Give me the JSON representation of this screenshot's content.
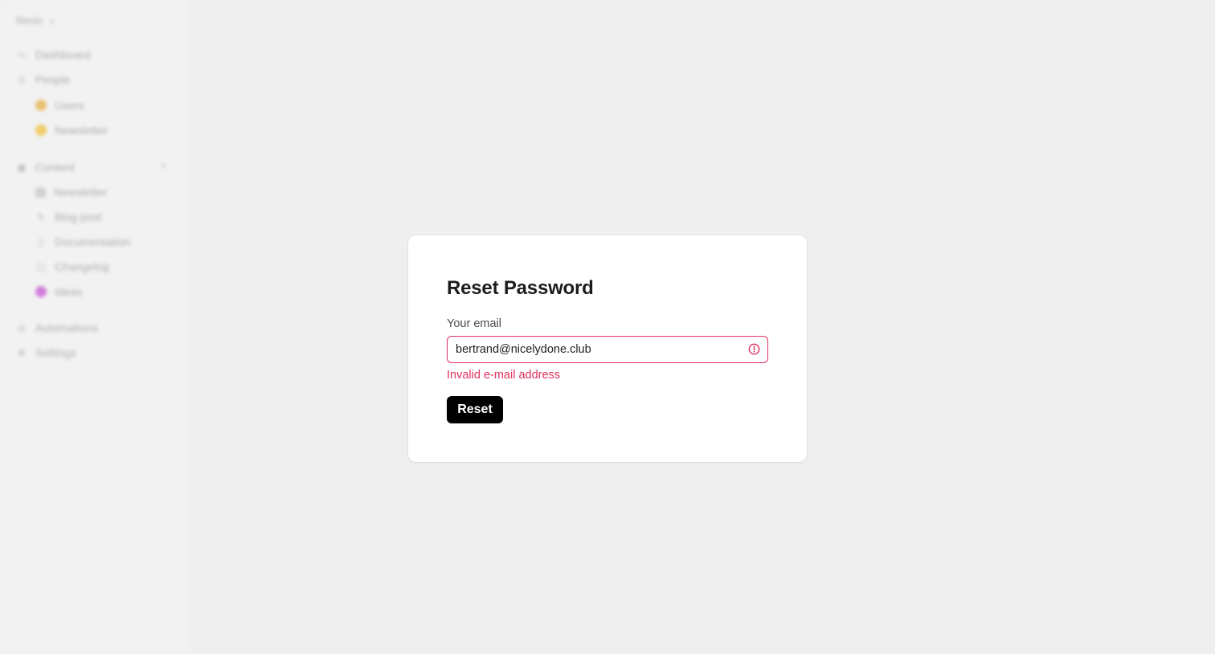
{
  "sidebar": {
    "workspace": "Resin",
    "items": [
      {
        "label": "Dashboard",
        "icon": "dashboard-icon"
      },
      {
        "label": "People",
        "icon": "person-icon"
      },
      {
        "label": "Users",
        "icon": "users-emoji-icon",
        "color": "#e8b24a"
      },
      {
        "label": "Newsletter",
        "icon": "newsletter-emoji-icon",
        "color": "#f0c23a"
      },
      {
        "label": "Content",
        "icon": "content-icon"
      },
      {
        "label": "Newsletter",
        "icon": "grid-icon"
      },
      {
        "label": "Blog post",
        "icon": "pen-icon"
      },
      {
        "label": "Documentation",
        "icon": "document-icon"
      },
      {
        "label": "Changelog",
        "icon": "calendar-icon"
      },
      {
        "label": "Ideas",
        "icon": "ideas-emoji-icon",
        "color": "#c85ad8"
      },
      {
        "label": "Automations",
        "icon": "automation-icon"
      },
      {
        "label": "Settings",
        "icon": "gear-icon"
      }
    ]
  },
  "dialog": {
    "title": "Reset Password",
    "email_label": "Your email",
    "email_value": "bertrand@nicelydone.club",
    "error_message": "Invalid e-mail address",
    "submit_label": "Reset",
    "error_color": "#e0305e"
  }
}
